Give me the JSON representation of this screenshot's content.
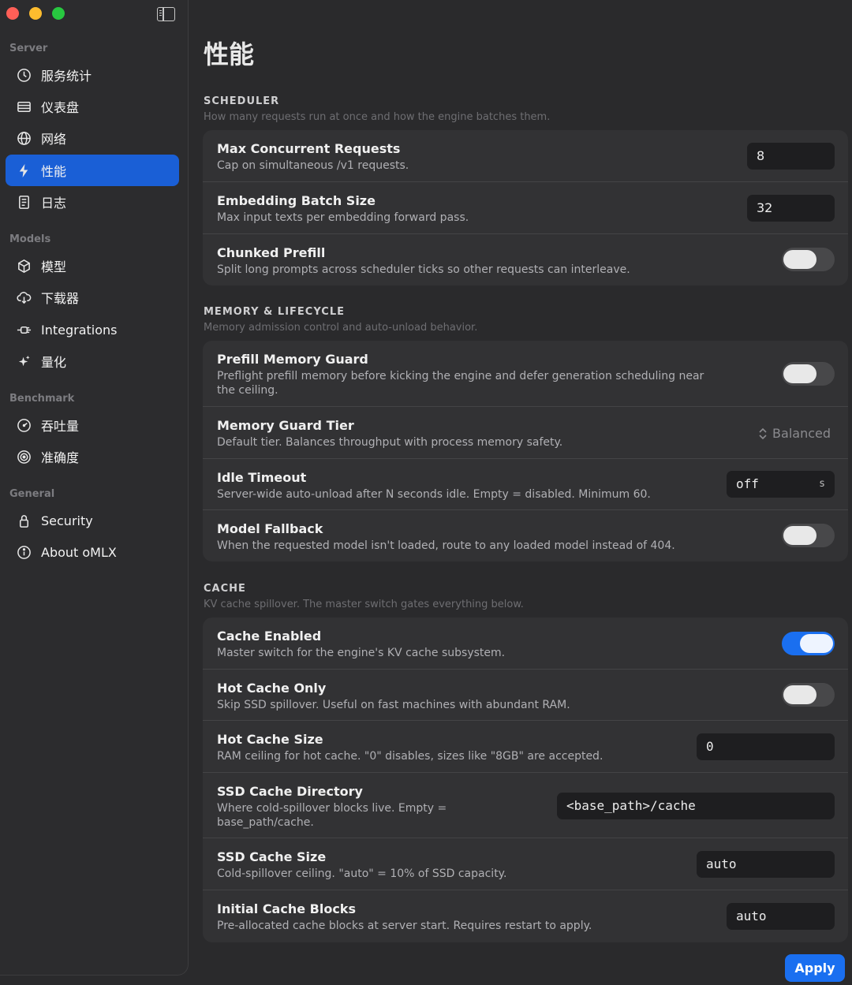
{
  "sidebar": {
    "sections": [
      {
        "title": "Server",
        "items": [
          {
            "icon": "speedometer-icon",
            "label": "服务统计"
          },
          {
            "icon": "dashboard-icon",
            "label": "仪表盘"
          },
          {
            "icon": "globe-icon",
            "label": "网络"
          },
          {
            "icon": "bolt-icon",
            "label": "性能",
            "active": true
          },
          {
            "icon": "log-icon",
            "label": "日志"
          }
        ]
      },
      {
        "title": "Models",
        "items": [
          {
            "icon": "cube-icon",
            "label": "模型"
          },
          {
            "icon": "cloud-download-icon",
            "label": "下载器"
          },
          {
            "icon": "plug-icon",
            "label": "Integrations"
          },
          {
            "icon": "sparkles-icon",
            "label": "量化"
          }
        ]
      },
      {
        "title": "Benchmark",
        "items": [
          {
            "icon": "gauge-icon",
            "label": "吞吐量"
          },
          {
            "icon": "target-icon",
            "label": "准确度"
          }
        ]
      },
      {
        "title": "General",
        "items": [
          {
            "icon": "lock-icon",
            "label": "Security"
          },
          {
            "icon": "info-icon",
            "label": "About oMLX"
          }
        ]
      }
    ]
  },
  "main": {
    "title": "性能",
    "groups": [
      {
        "title": "SCHEDULER",
        "desc": "How many requests run at once and how the engine batches them.",
        "rows": [
          {
            "title": "Max Concurrent Requests",
            "desc": "Cap on simultaneous /v1 requests.",
            "value": "8"
          },
          {
            "title": "Embedding Batch Size",
            "desc": "Max input texts per embedding forward pass.",
            "value": "32"
          },
          {
            "title": "Chunked Prefill",
            "desc": "Split long prompts across scheduler ticks so other requests can interleave.",
            "toggle": false
          }
        ]
      },
      {
        "title": "MEMORY & LIFECYCLE",
        "desc": "Memory admission control and auto-unload behavior.",
        "rows": [
          {
            "title": "Prefill Memory Guard",
            "desc": "Preflight prefill memory before kicking the engine and defer generation scheduling near the ceiling.",
            "toggle": false
          },
          {
            "title": "Memory Guard Tier",
            "desc": "Default tier. Balances throughput with process memory safety.",
            "value": "Balanced"
          },
          {
            "title": "Idle Timeout",
            "desc": "Server-wide auto-unload after N seconds idle. Empty = disabled. Minimum 60.",
            "value": "off",
            "unit": "s"
          },
          {
            "title": "Model Fallback",
            "desc": "When the requested model isn't loaded, route to any loaded model instead of 404.",
            "toggle": false
          }
        ]
      },
      {
        "title": "CACHE",
        "desc": "KV cache spillover. The master switch gates everything below.",
        "rows": [
          {
            "title": "Cache Enabled",
            "desc": "Master switch for the engine's KV cache subsystem.",
            "toggle": true
          },
          {
            "title": "Hot Cache Only",
            "desc": "Skip SSD spillover. Useful on fast machines with abundant RAM.",
            "toggle": false
          },
          {
            "title": "Hot Cache Size",
            "desc": "RAM ceiling for hot cache. \"0\" disables, sizes like \"8GB\" are accepted.",
            "value": "0"
          },
          {
            "title": "SSD Cache Directory",
            "desc": "Where cold-spillover blocks live. Empty = base_path/cache.",
            "value": "<base_path>/cache"
          },
          {
            "title": "SSD Cache Size",
            "desc": "Cold-spillover ceiling. \"auto\" = 10% of SSD capacity.",
            "value": "auto"
          },
          {
            "title": "Initial Cache Blocks",
            "desc": "Pre-allocated cache blocks at server start. Requires restart to apply.",
            "value": "auto"
          }
        ]
      }
    ],
    "apply_label": "Apply"
  }
}
